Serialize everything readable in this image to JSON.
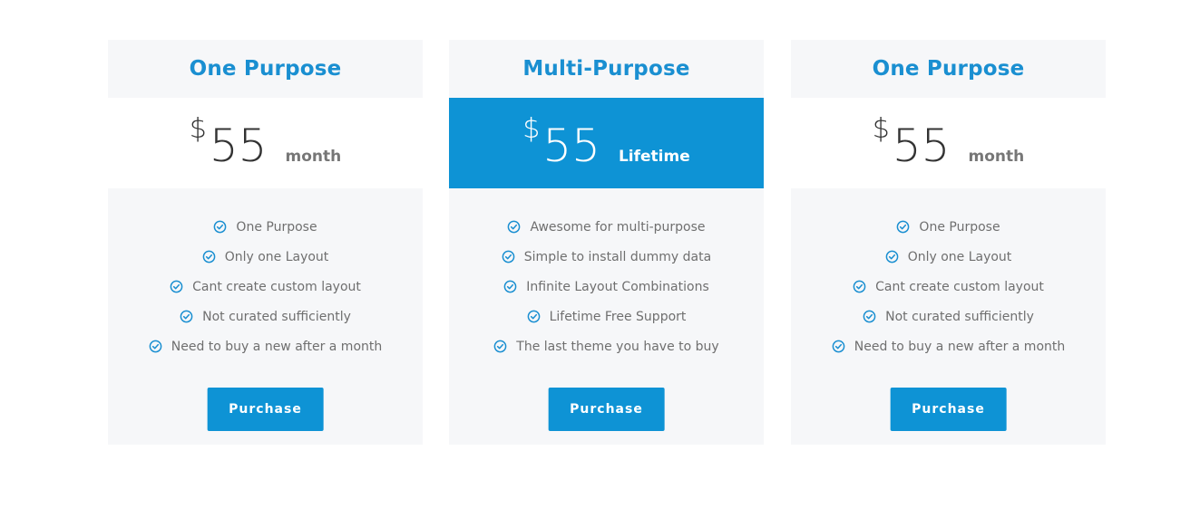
{
  "plans": [
    {
      "title": "One Purpose",
      "currency": "$",
      "amount": "55",
      "period": "month",
      "features": [
        "One Purpose",
        "Only one Layout",
        "Cant create custom layout",
        "Not curated sufficiently",
        "Need to buy a new after a month"
      ],
      "button_label": "Purchase"
    },
    {
      "title": "Multi-Purpose",
      "currency": "$",
      "amount": "55",
      "period": "Lifetime",
      "features": [
        "Awesome for multi-purpose",
        "Simple to install dummy data",
        "Infinite Layout Combinations",
        "Lifetime Free Support",
        "The last theme you have to buy"
      ],
      "button_label": "Purchase"
    },
    {
      "title": "One Purpose",
      "currency": "$",
      "amount": "55",
      "period": "month",
      "features": [
        "One Purpose",
        "Only one Layout",
        "Cant create custom layout",
        "Not curated sufficiently",
        "Need to buy a new after a month"
      ],
      "button_label": "Purchase"
    }
  ],
  "colors": {
    "accent": "#0e93d5",
    "title": "#1a8fd1",
    "card_bg": "#f6f7f9",
    "feature_text": "#6f6f6f"
  },
  "icons": {
    "feature": "check-circle-icon"
  }
}
